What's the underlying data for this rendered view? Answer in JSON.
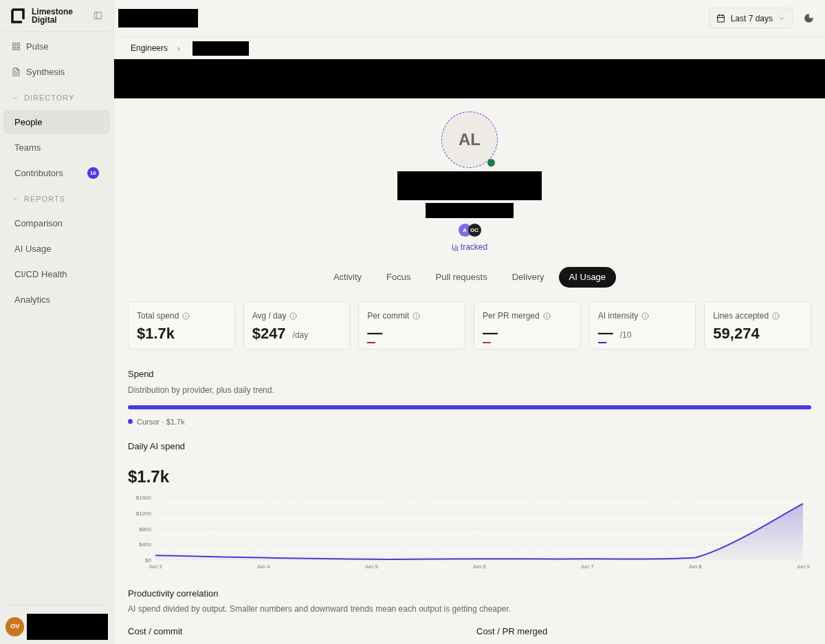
{
  "brand": {
    "line1": "Limestone",
    "line2": "Digital"
  },
  "sidebar": {
    "top_items": [
      {
        "label": "Pulse",
        "selected": false
      },
      {
        "label": "Synthesis",
        "selected": false
      }
    ],
    "sections": [
      {
        "title": "DIRECTORY",
        "expanded": true,
        "items": [
          {
            "label": "People",
            "selected": true
          },
          {
            "label": "Teams",
            "selected": false
          },
          {
            "label": "Contributors",
            "selected": false,
            "badge": "16"
          }
        ]
      },
      {
        "title": "REPORTS",
        "expanded": true,
        "items": [
          {
            "label": "Comparison",
            "selected": false
          },
          {
            "label": "AI Usage",
            "selected": false
          },
          {
            "label": "CI/CD Health",
            "selected": false
          },
          {
            "label": "Analytics",
            "selected": false
          }
        ]
      }
    ],
    "user": {
      "initials": "OV"
    }
  },
  "topbar": {
    "date_range": "Last 7 days"
  },
  "breadcrumb": {
    "items": [
      "Engineers"
    ],
    "separator": "›"
  },
  "profile": {
    "initials": "AL",
    "online": true,
    "sources": [
      {
        "initials": "A",
        "color": "#7c6ee6"
      },
      {
        "initials": "OC",
        "color": "#1f1f1f"
      }
    ],
    "tracked": "tracked"
  },
  "tabs": [
    {
      "label": "Activity",
      "selected": false
    },
    {
      "label": "Focus",
      "selected": false
    },
    {
      "label": "Pull requests",
      "selected": false
    },
    {
      "label": "Delivery",
      "selected": false
    },
    {
      "label": "AI Usage",
      "selected": true
    }
  ],
  "metrics": [
    {
      "label": "Total spend",
      "value": "$1.7k",
      "kind": "value"
    },
    {
      "label": "Avg / day",
      "value": "$247",
      "suffix": "/day",
      "kind": "value"
    },
    {
      "label": "Per commit",
      "value": "—",
      "kind": "dash",
      "color": "#8a3a12"
    },
    {
      "label": "Per PR merged",
      "value": "—",
      "kind": "dash",
      "color": "#c0307a"
    },
    {
      "label": "AI intensity",
      "value": "—",
      "suffix": "/10",
      "kind": "dash",
      "color": "#2a2ad6"
    },
    {
      "label": "Lines accepted",
      "value": "59,274",
      "kind": "value"
    }
  ],
  "spend": {
    "title": "Spend",
    "subtitle": "Distribution by provider, plus daily trend.",
    "providers": [
      {
        "label": "Cursor · $1.7k",
        "color": "#4a3ae0",
        "level": 1
      }
    ]
  },
  "daily": {
    "title": "Daily AI spend",
    "total": "$1.7k",
    "chart_data": {
      "type": "area",
      "categories": [
        "Jun 3",
        "Jun 4",
        "Jun 5",
        "Jun 6",
        "Jun 7",
        "Jun 8",
        "Jun 9"
      ],
      "grid": true,
      "series": [
        {
          "color": "#4a3ad0",
          "values": [
            120,
            60,
            20,
            30,
            30,
            60,
            1440
          ]
        }
      ],
      "ylim": [
        0,
        1600
      ],
      "yticks": [
        {
          "value": 0,
          "label": "$0"
        },
        {
          "value": 400,
          "label": "$400"
        },
        {
          "value": 800,
          "label": "$800"
        },
        {
          "value": 1200,
          "label": "$1200"
        },
        {
          "value": 1600,
          "label": "$1600"
        }
      ]
    }
  },
  "productivity": {
    "title": "Productivity correlation",
    "subtitle": "AI spend divided by output. Smaller numbers and downward trends mean each output is getting cheaper.",
    "columns": [
      "Cost / commit",
      "Cost / PR merged"
    ]
  }
}
